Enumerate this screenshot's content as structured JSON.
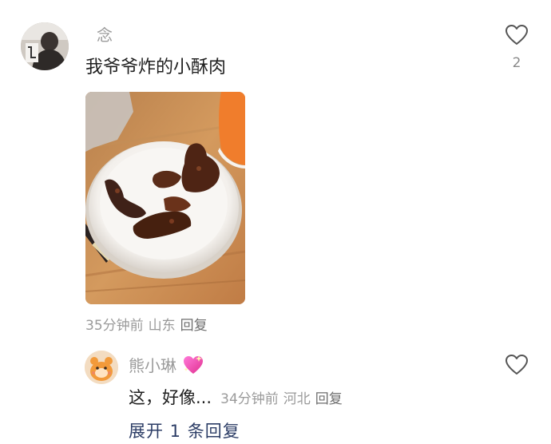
{
  "comment": {
    "username": "念",
    "text": "我爷爷炸的小酥肉",
    "time": "35分钟前",
    "location": "山东",
    "reply_label": "回复",
    "like_count": "2"
  },
  "reply": {
    "username": "熊小琳",
    "emoji": "💖",
    "text": "这，好像...",
    "time": "34分钟前",
    "location": "河北",
    "reply_label": "回复"
  },
  "expand_label": "展开 1 条回复",
  "colors": {
    "name_gray": "#9b9b9b",
    "meta_gray": "#9a9a9a",
    "link_blue": "#2c3d66",
    "heart_outline": "#555555"
  },
  "icons": [
    "heart-outline-icon",
    "sparkling-heart-icon"
  ]
}
